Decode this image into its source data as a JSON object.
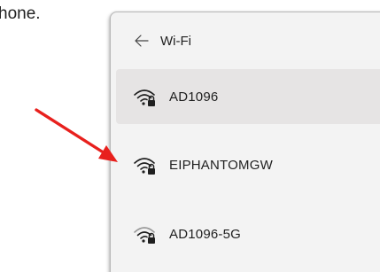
{
  "document": {
    "fragment_text": "hone."
  },
  "wifi_panel": {
    "back_icon": "arrow-left-icon",
    "title": "Wi-Fi",
    "networks": [
      {
        "ssid": "AD1096",
        "icon": "wifi-secured-icon",
        "selected": true
      },
      {
        "ssid": "EIPHANTOMGW",
        "icon": "wifi-secured-icon",
        "selected": false
      },
      {
        "ssid": "AD1096-5G",
        "icon": "wifi-secured-icon",
        "selected": false
      }
    ]
  },
  "annotation": {
    "arrow_color": "#e8201d"
  },
  "colors": {
    "panel_bg": "#f3f3f3",
    "selected_bg": "#e6e4e4",
    "text": "#1f1f1f"
  }
}
